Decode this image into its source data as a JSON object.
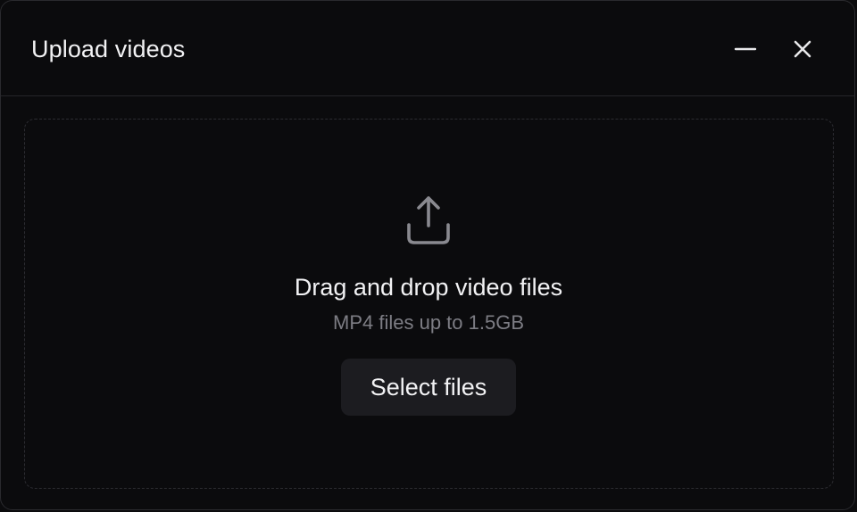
{
  "dialog": {
    "title": "Upload videos",
    "minimize_icon": "minus-icon",
    "close_icon": "close-icon"
  },
  "dropzone": {
    "icon": "upload-icon",
    "title": "Drag and drop video files",
    "subtitle": "MP4 files up to 1.5GB",
    "button_label": "Select files"
  },
  "colors": {
    "background": "#0b0b0d",
    "text": "#f2f2f4",
    "muted_text": "#7d7d84",
    "icon": "#8a8a90",
    "button_bg": "#1c1c20",
    "border": "#2a2a2e"
  }
}
